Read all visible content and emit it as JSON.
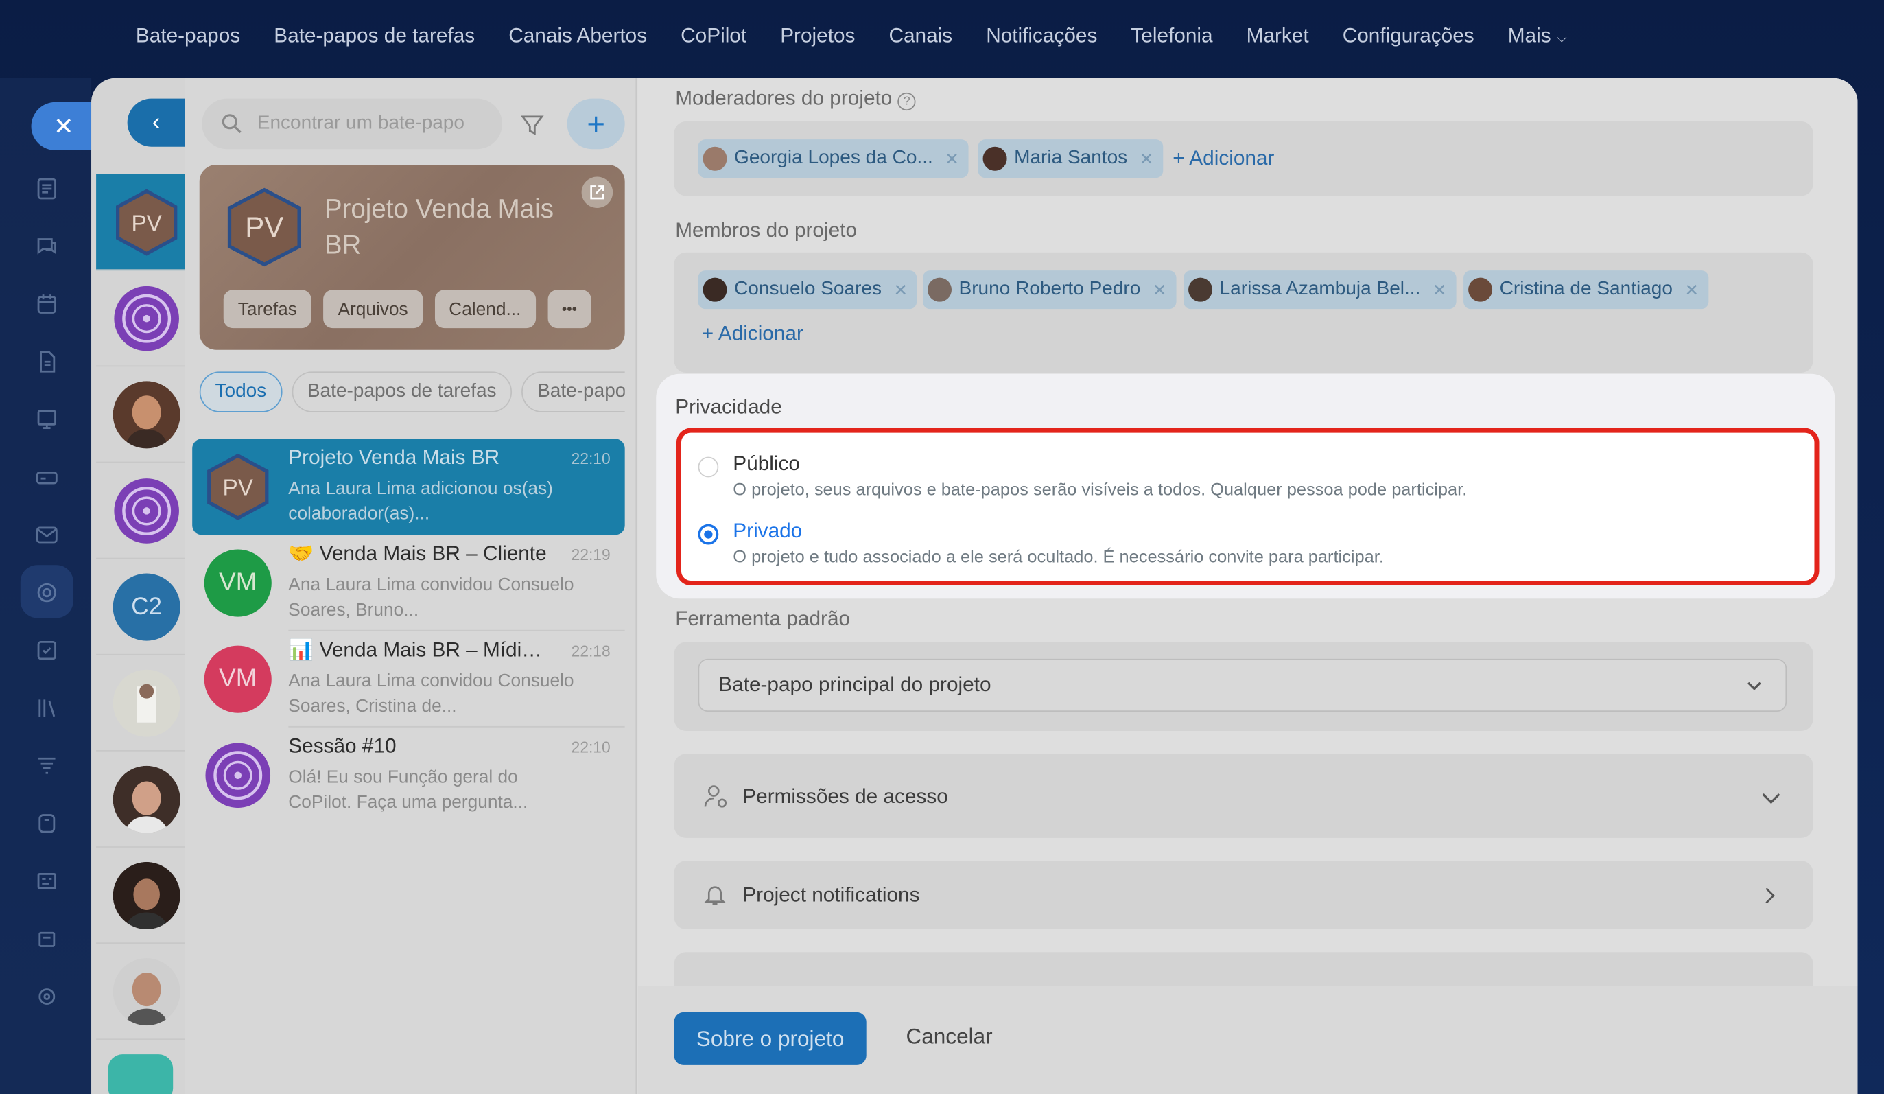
{
  "topnav": [
    "Bate-papos",
    "Bate-papos de tarefas",
    "Canais Abertos",
    "CoPilot",
    "Projetos",
    "Canais",
    "Notificações",
    "Telefonia",
    "Market",
    "Configurações",
    "Mais"
  ],
  "search": {
    "placeholder": "Encontrar um bate-papo"
  },
  "project_card": {
    "initials": "PV",
    "name": "Projeto Venda Mais BR",
    "buttons": [
      "Tarefas",
      "Arquivos",
      "Calend...",
      "•••"
    ]
  },
  "filters": [
    "Todos",
    "Bate-papos de tarefas",
    "Bate-papos"
  ],
  "avatar_column": [
    {
      "initials": "PV",
      "kind": "hex"
    },
    {
      "kind": "copilot"
    },
    {
      "kind": "photo"
    },
    {
      "kind": "copilot"
    },
    {
      "initials": "C2",
      "kind": "circle"
    },
    {
      "kind": "photo"
    },
    {
      "kind": "photo"
    },
    {
      "kind": "photo"
    },
    {
      "kind": "photo"
    }
  ],
  "chats": [
    {
      "initials": "PV",
      "title": "Projeto Venda Mais BR",
      "time": "22:10",
      "preview": "Ana Laura Lima adicionou os(as) colaborador(as)...",
      "selected": true
    },
    {
      "initials": "VM",
      "title": "🤝 Venda Mais BR – Cliente",
      "time": "22:19",
      "preview": "Ana Laura Lima convidou Consuelo Soares, Bruno...",
      "color": "#1e9b46"
    },
    {
      "initials": "VM",
      "title": "📊 Venda Mais BR – Mídia ...",
      "time": "22:18",
      "preview": "Ana Laura Lima convidou Consuelo Soares, Cristina de...",
      "color": "#d43b5e"
    },
    {
      "title": "Sessão #10",
      "time": "22:10",
      "preview": "Olá! Eu sou Função geral do CoPilot. Faça uma pergunta...",
      "copilot": true
    }
  ],
  "moderators": {
    "label": "Moderadores do projeto",
    "people": [
      "Georgia Lopes da Co...",
      "Maria Santos"
    ],
    "add": "+ Adicionar"
  },
  "members": {
    "label": "Membros do projeto",
    "people": [
      "Consuelo Soares",
      "Bruno Roberto Pedro",
      "Larissa Azambuja Bel...",
      "Cristina de Santiago"
    ],
    "add": "+ Adicionar"
  },
  "privacy": {
    "label": "Privacidade",
    "options": [
      {
        "title": "Público",
        "desc": "O projeto, seus arquivos e bate-papos serão visíveis a todos. Qualquer pessoa pode participar.",
        "checked": false
      },
      {
        "title": "Privado",
        "desc": "O projeto e tudo associado a ele será ocultado. É necessário convite para participar.",
        "checked": true
      }
    ]
  },
  "default_tool": {
    "label": "Ferramenta padrão",
    "value": "Bate-papo principal do projeto"
  },
  "access": {
    "label": "Permissões de acesso"
  },
  "notifications": {
    "label": "Project notifications"
  },
  "footer": {
    "primary": "Sobre o projeto",
    "cancel": "Cancelar"
  },
  "colors": {
    "accent": "#1a73e8",
    "highlight": "#e3241b",
    "nav_bg": "#0b1d45"
  }
}
